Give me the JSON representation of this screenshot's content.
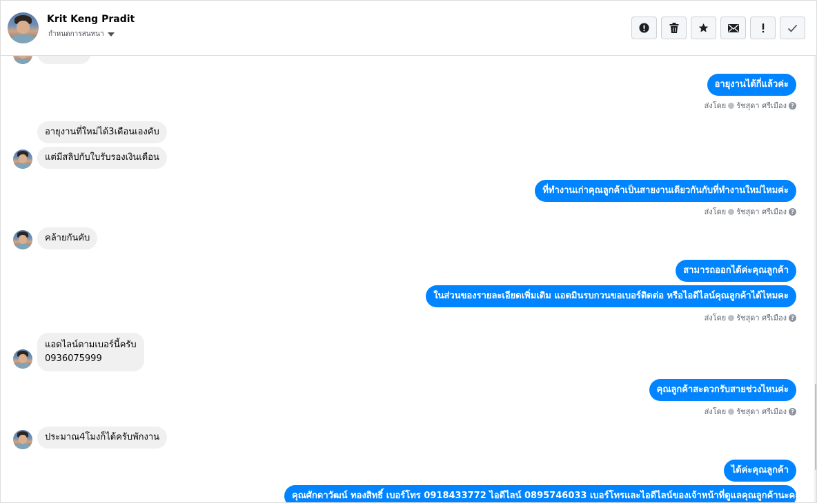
{
  "header": {
    "contact_name": "Krit Keng Pradit",
    "conversation_setting": "กำหนดการสนทนา",
    "actions": [
      {
        "icon": "alert-circle-icon",
        "name": "spam-button"
      },
      {
        "icon": "trash-icon",
        "name": "delete-button"
      },
      {
        "icon": "star-icon",
        "name": "star-button"
      },
      {
        "icon": "envelope-icon",
        "name": "mark-unread-button"
      },
      {
        "icon": "exclamation-icon",
        "name": "important-button"
      },
      {
        "icon": "checkmark-icon",
        "name": "done-button"
      }
    ]
  },
  "messages": {
    "out_1": "อายุงานได้กี่แล้วค่ะ",
    "in_1a": "อายุงานที่ใหม่ได้3เดือนเองคับ",
    "in_1b": "แต่มีสลิปกับใบรับรองเงินเดือน",
    "out_2": "ที่ทำงานเก่าคุณลูกค้าเป็นสายงานเดียวกันกับที่ทำงานใหม่ไหมค่ะ",
    "in_2": "คล้ายกันคับ",
    "out_3a": "สามารถออกได้ค่ะคุณลูกค้า",
    "out_3b": "ในส่วนของรายละเอียดเพิ่มเติม แอดมินรบกวนขอเบอร์ติดต่อ หรือไอดีไลน์คุณลูกค้าได้ไหมคะ",
    "in_3_line1": "แอดไลน์ตามเบอร์นี้ครับ",
    "in_3_line2": "0936075999",
    "out_4": "คุณลูกค้าสะดวกรับสายช่วงไหนค่ะ",
    "in_4": "ประมาณ4โมงก็ได้ครับพักงาน",
    "out_5": "ได้ค่ะคุณลูกค้า",
    "out_6_partial": "คุณศักดาวัฒน์ ทองสิทธิ์ เบอร์โทร 0918433772 ไอดีไลน์ 0895746033 เบอร์โทรและไอดีไลน์ของเจ้าหน้าที่ดูแลคุณลูกค้านะคะ"
  },
  "sent_by": {
    "prefix": "ส่งโดย",
    "agent": "รัชสุดา ศรีเมือง"
  },
  "colors": {
    "outgoing": "#0084ff",
    "incoming": "#f0f0f0"
  }
}
